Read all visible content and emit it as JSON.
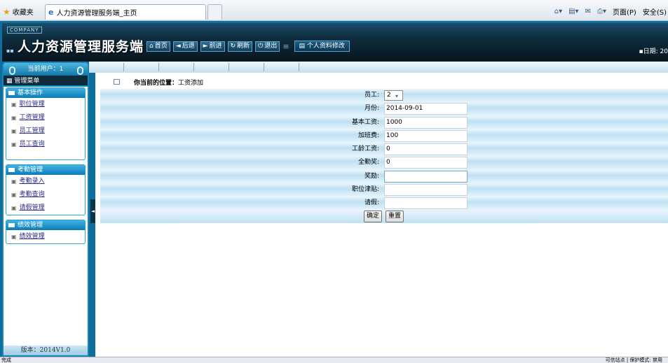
{
  "browser": {
    "favorites": "收藏夹",
    "tab_title": "人力资源管理服务端_主页",
    "tools": {
      "page": "页面(P)",
      "safety": "安全(S)"
    }
  },
  "header": {
    "company": "COMPANY",
    "title": "人力资源管理服务端",
    "nav": [
      "首页",
      "后退",
      "前进",
      "刷新",
      "退出"
    ],
    "profile_button": "个人资料修改",
    "date_label": "日期: 20"
  },
  "sidebar": {
    "current_user": "当前用户：1",
    "menu_title": "管理菜单",
    "groups": [
      {
        "title": "基本操作",
        "items": [
          "职位管理",
          "工资管理",
          "员工管理",
          "员工查询"
        ]
      },
      {
        "title": "考勤管理",
        "items": [
          "考勤录入",
          "考勤查询",
          "请假管理"
        ]
      },
      {
        "title": "绩效管理",
        "items": [
          "绩效管理"
        ]
      }
    ],
    "version": "版本：2014V1.0"
  },
  "location": {
    "prefix": "你当前的位置：",
    "page": "工资添加"
  },
  "form": {
    "fields": [
      {
        "label": "员工:",
        "value": "2",
        "type": "select"
      },
      {
        "label": "月份:",
        "value": "2014-09-01"
      },
      {
        "label": "基本工资:",
        "value": "1000"
      },
      {
        "label": "加班费:",
        "value": "100"
      },
      {
        "label": "工龄工资:",
        "value": "0"
      },
      {
        "label": "全勤奖:",
        "value": "0"
      },
      {
        "label": "奖励:",
        "value": ""
      },
      {
        "label": "职位津贴:",
        "value": ""
      },
      {
        "label": "请假:",
        "value": ""
      }
    ],
    "buttons": {
      "submit": "确定",
      "reset": "重置"
    }
  },
  "status": {
    "left": "完成",
    "right": "可信站点 | 保护模式: 禁用"
  }
}
